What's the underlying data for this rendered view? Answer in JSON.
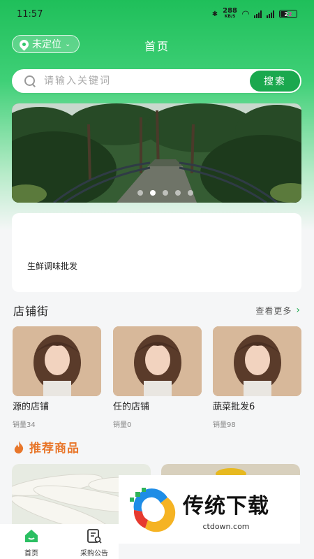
{
  "status_bar": {
    "time": "11:57",
    "network_speed": "288",
    "network_unit": "KB/S",
    "battery": "22"
  },
  "header": {
    "location_label": "未定位",
    "title": "首页"
  },
  "search": {
    "placeholder": "请输入关键词",
    "button_label": "搜索"
  },
  "banner": {
    "slide_count": 5,
    "active_index": 1
  },
  "categories": [
    {
      "label": "生鲜调味批发"
    }
  ],
  "shop_street": {
    "title": "店铺街",
    "more_label": "查看更多",
    "shops": [
      {
        "name": "源的店铺",
        "sales": "销量34"
      },
      {
        "name": "任的店铺",
        "sales": "销量0"
      },
      {
        "name": "蔬菜批发6",
        "sales": "销量98"
      }
    ]
  },
  "recommended": {
    "title": "推荐商品"
  },
  "watermark": {
    "title": "传统下载",
    "url": "ctdown.com"
  },
  "bottom_nav": [
    {
      "label": "首页",
      "icon": "home-icon",
      "active": true
    },
    {
      "label": "采购公告",
      "icon": "notice-icon",
      "active": false
    }
  ],
  "colors": {
    "brand_green": "#1aa84e",
    "accent_orange": "#e8762a"
  }
}
